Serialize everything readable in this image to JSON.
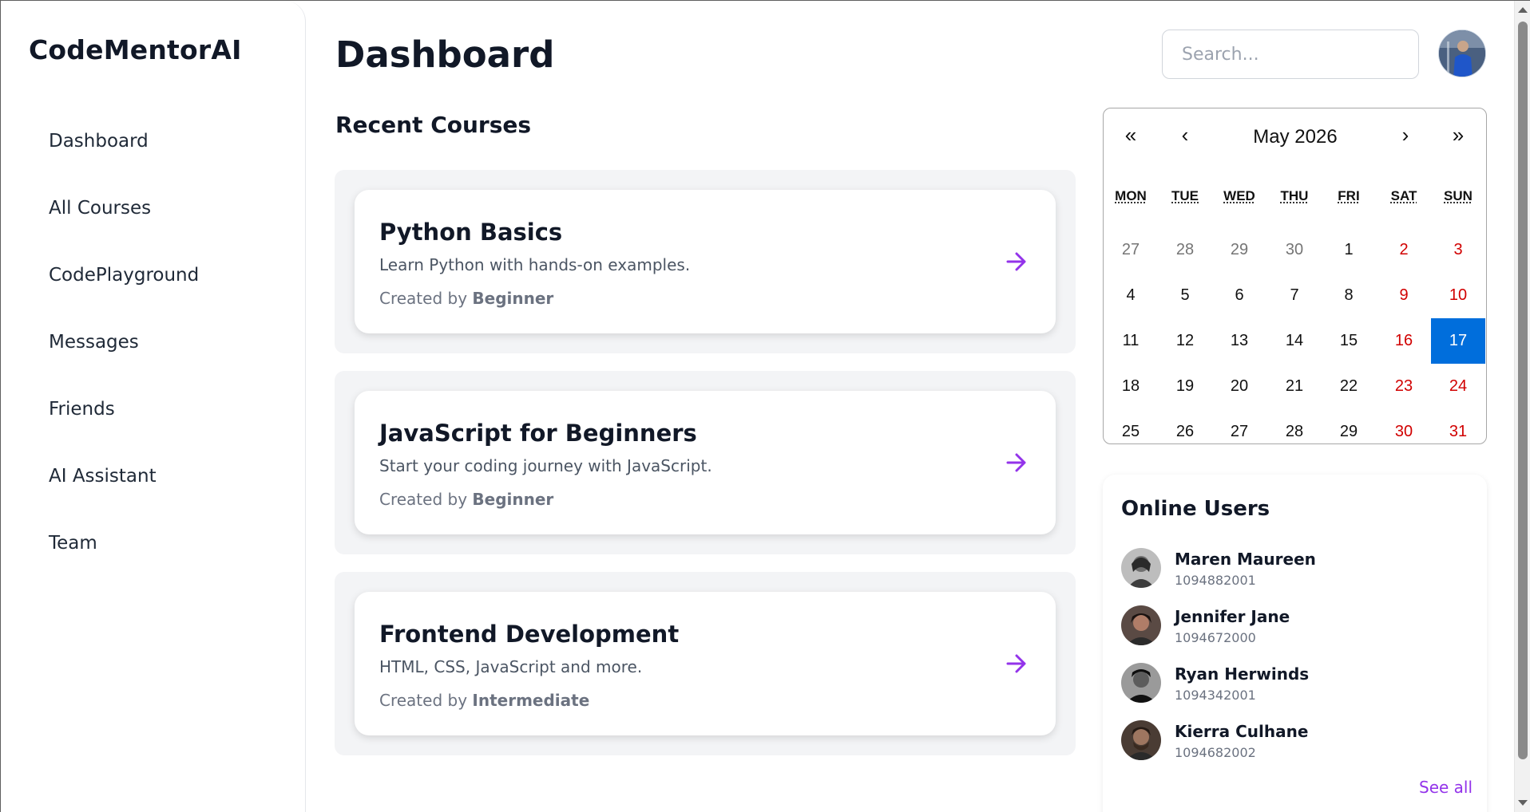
{
  "brand": "CodeMentorAI",
  "sidebar": {
    "items": [
      {
        "label": "Dashboard"
      },
      {
        "label": "All Courses"
      },
      {
        "label": "CodePlayground"
      },
      {
        "label": "Messages"
      },
      {
        "label": "Friends"
      },
      {
        "label": "AI Assistant"
      },
      {
        "label": "Team"
      }
    ]
  },
  "header": {
    "title": "Dashboard",
    "search_placeholder": "Search..."
  },
  "courses": {
    "title": "Recent Courses",
    "created_by_prefix": "Created by",
    "items": [
      {
        "title": "Python Basics",
        "description": "Learn Python with hands-on examples.",
        "level": "Beginner"
      },
      {
        "title": "JavaScript for Beginners",
        "description": "Start your coding journey with JavaScript.",
        "level": "Beginner"
      },
      {
        "title": "Frontend Development",
        "description": "HTML, CSS, JavaScript and more.",
        "level": "Intermediate"
      }
    ]
  },
  "calendar": {
    "month_label": "May 2026",
    "nav": {
      "prev2": "«",
      "prev": "‹",
      "next": "›",
      "next2": "»"
    },
    "weekdays": [
      "MON",
      "TUE",
      "WED",
      "THU",
      "FRI",
      "SAT",
      "SUN"
    ],
    "weeks": [
      [
        "27",
        "28",
        "29",
        "30",
        "1",
        "2",
        "3"
      ],
      [
        "4",
        "5",
        "6",
        "7",
        "8",
        "9",
        "10"
      ],
      [
        "11",
        "12",
        "13",
        "14",
        "15",
        "16",
        "17"
      ],
      [
        "18",
        "19",
        "20",
        "21",
        "22",
        "23",
        "24"
      ],
      [
        "25",
        "26",
        "27",
        "28",
        "29",
        "30",
        "31"
      ]
    ],
    "selected": "17",
    "colors": {
      "weekend": "#d10000",
      "selected_bg": "#006edc",
      "muted": "#757575"
    }
  },
  "online_users": {
    "title": "Online Users",
    "users": [
      {
        "name": "Maren Maureen",
        "id": "1094882001"
      },
      {
        "name": "Jennifer Jane",
        "id": "1094672000"
      },
      {
        "name": "Ryan Herwinds",
        "id": "1094342001"
      },
      {
        "name": "Kierra Culhane",
        "id": "1094682002"
      }
    ],
    "see_all": "See all"
  },
  "colors": {
    "accent": "#9333ea"
  }
}
